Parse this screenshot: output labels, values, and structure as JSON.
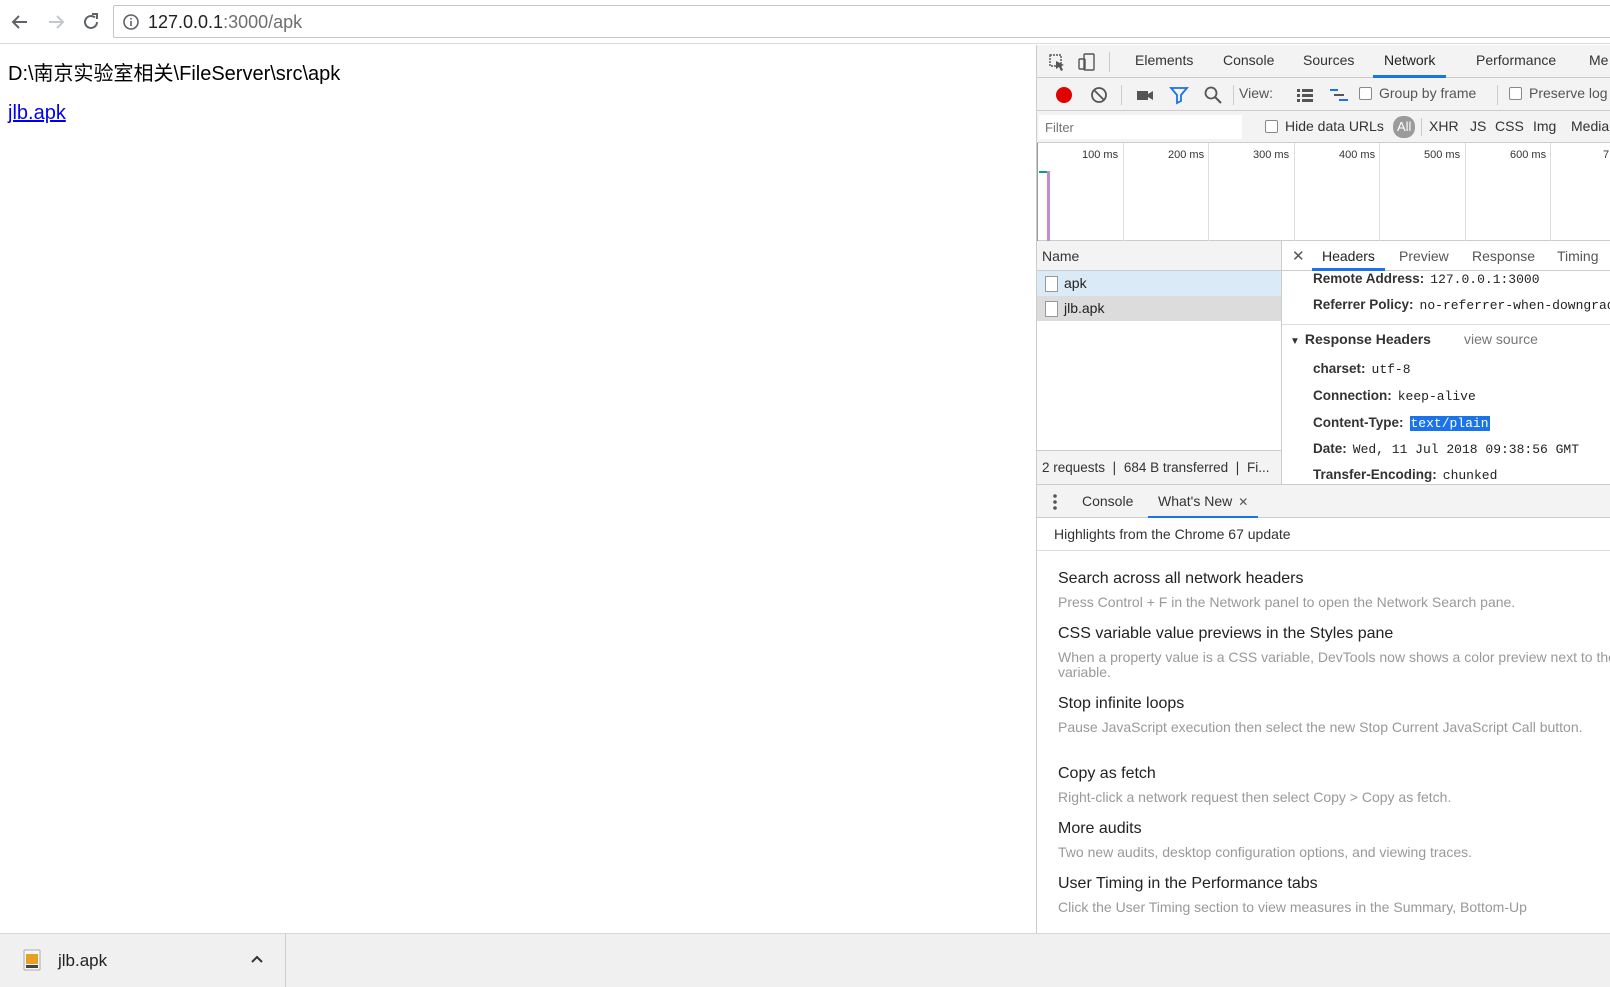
{
  "browser": {
    "url_host": "127.0.0.1",
    "url_rest": ":3000/apk"
  },
  "page": {
    "directory_title": "D:\\南京实验室相关\\FileServer\\src\\apk",
    "file_link": "jlb.apk"
  },
  "devtools": {
    "tabs": [
      "Elements",
      "Console",
      "Sources",
      "Network",
      "Performance",
      "Me"
    ],
    "active_tab": "Network",
    "toolbar": {
      "view_label": "View:",
      "group_by_frame": "Group by frame",
      "preserve_log": "Preserve log"
    },
    "filter": {
      "placeholder": "Filter",
      "hide_data_urls": "Hide data URLs",
      "types": [
        "All",
        "XHR",
        "JS",
        "CSS",
        "Img",
        "Media"
      ]
    },
    "timeline_ticks": [
      "100 ms",
      "200 ms",
      "300 ms",
      "400 ms",
      "500 ms",
      "600 ms",
      "7"
    ],
    "requests": {
      "column_name": "Name",
      "rows": [
        "apk",
        "jlb.apk"
      ],
      "summary": "2 requests  ❘  684 B transferred  ❘  Fi..."
    },
    "detail": {
      "tabs": [
        "Headers",
        "Preview",
        "Response",
        "Timing"
      ],
      "general": [
        {
          "key": "Remote Address:",
          "value": "127.0.0.1:3000"
        },
        {
          "key": "Referrer Policy:",
          "value": "no-referrer-when-downgrade"
        }
      ],
      "response_headers_title": "Response Headers",
      "view_source": "view source",
      "response_headers": [
        {
          "key": "charset:",
          "value": "utf-8"
        },
        {
          "key": "Connection:",
          "value": "keep-alive"
        },
        {
          "key": "Content-Type:",
          "value": "text/plain"
        },
        {
          "key": "Date:",
          "value": "Wed, 11 Jul 2018 09:38:56 GMT"
        },
        {
          "key": "Transfer-Encoding:",
          "value": "chunked"
        }
      ]
    },
    "drawer": {
      "tabs": [
        "Console",
        "What's New"
      ],
      "highlights": "Highlights from the Chrome 67 update",
      "items": [
        {
          "title": "Search across all network headers",
          "desc": "Press Control + F in the Network panel to open the Network Search pane."
        },
        {
          "title": "CSS variable value previews in the Styles pane",
          "desc": "When a property value is a CSS variable, DevTools now shows a color preview next to the variable."
        },
        {
          "title": "Stop infinite loops",
          "desc": "Pause JavaScript execution then select the new Stop Current JavaScript Call button."
        },
        {
          "title": "Copy as fetch",
          "desc": "Right-click a network request then select Copy > Copy as fetch."
        },
        {
          "title": "More audits",
          "desc": "Two new audits, desktop configuration options, and viewing traces."
        },
        {
          "title": "User Timing in the Performance tabs",
          "desc": "Click the User Timing section to view measures in the Summary, Bottom-Up"
        }
      ]
    }
  },
  "download_shelf": {
    "file_name": "jlb.apk"
  },
  "colors": {
    "accent": "#1a73e8",
    "link": "#0000ee",
    "record": "#e00000"
  }
}
